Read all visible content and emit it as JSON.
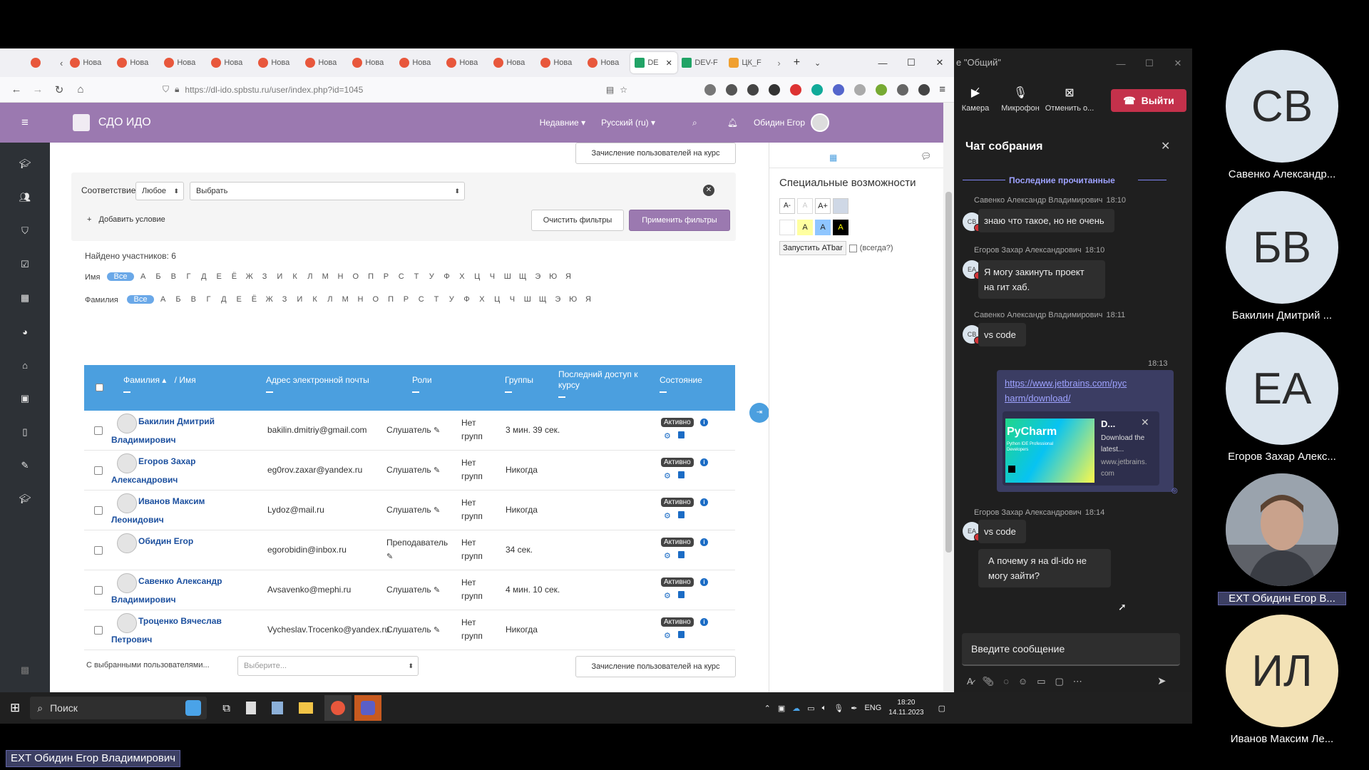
{
  "browser": {
    "tabs": [
      {
        "label": "Нова",
        "type": "moodle"
      },
      {
        "label": "Нова",
        "type": "moodle"
      },
      {
        "label": "Нова",
        "type": "moodle"
      },
      {
        "label": "Нова",
        "type": "moodle"
      },
      {
        "label": "Нова",
        "type": "moodle"
      },
      {
        "label": "Нова",
        "type": "moodle"
      },
      {
        "label": "Нова",
        "type": "moodle"
      },
      {
        "label": "Нова",
        "type": "moodle"
      },
      {
        "label": "Нова",
        "type": "moodle"
      },
      {
        "label": "Нова",
        "type": "moodle"
      },
      {
        "label": "Нова",
        "type": "moodle"
      },
      {
        "label": "Нова",
        "type": "moodle"
      }
    ],
    "active_tab": "DE",
    "tab_dev": "DEV-F",
    "tab_ck": "ЦК_F",
    "url": "https://dl-ido.spbstu.ru/user/index.php?id=1045"
  },
  "moodle": {
    "site_name": "СДО ИДО",
    "nav_recent": "Недавние",
    "nav_lang": "Русский (ru)",
    "user_name": "Обидин Егор",
    "enroll_button": "Зачисление пользователей на курс",
    "filter": {
      "match_label": "Соответствие",
      "match_value": "Любое",
      "select_value": "Выбрать",
      "add_condition": "Добавить условие",
      "clear": "Очистить фильтры",
      "apply": "Применить фильтры"
    },
    "found": "Найдено участников: 6",
    "first_name_label": "Имя",
    "last_name_label": "Фамилия",
    "all_label": "Все",
    "alphabet": [
      "А",
      "Б",
      "В",
      "Г",
      "Д",
      "Е",
      "Ё",
      "Ж",
      "З",
      "И",
      "К",
      "Л",
      "М",
      "Н",
      "О",
      "П",
      "Р",
      "С",
      "Т",
      "У",
      "Ф",
      "Х",
      "Ц",
      "Ч",
      "Ш",
      "Щ",
      "Э",
      "Ю",
      "Я"
    ],
    "table_headers": {
      "surname": "Фамилия",
      "name": "/ Имя",
      "email": "Адрес электронной почты",
      "roles": "Роли",
      "groups": "Группы",
      "last_access": "Последний доступ к курсу",
      "status": "Состояние"
    },
    "rows": [
      {
        "name": "Бакилин Дмитрий Владимирович",
        "email": "bakilin.dmitriy@gmail.com",
        "role": "Слушатель",
        "groups": "Нет групп",
        "last": "3 мин. 39 сек.",
        "status": "Активно"
      },
      {
        "name": "Егоров Захар Александрович",
        "email": "eg0rov.zaxar@yandex.ru",
        "role": "Слушатель",
        "groups": "Нет групп",
        "last": "Никогда",
        "status": "Активно"
      },
      {
        "name": "Иванов Максим Леонидович",
        "email": "Lydoz@mail.ru",
        "role": "Слушатель",
        "groups": "Нет групп",
        "last": "Никогда",
        "status": "Активно"
      },
      {
        "name": "Обидин Егор",
        "email": "egorobidin@inbox.ru",
        "role": "Преподаватель",
        "groups": "Нет групп",
        "last": "34 сек.",
        "status": "Активно"
      },
      {
        "name": "Савенко Александр Владимирович",
        "email": "Avsavenko@mephi.ru",
        "role": "Слушатель",
        "groups": "Нет групп",
        "last": "4 мин. 10 сек.",
        "status": "Активно"
      },
      {
        "name": "Троценко Вячеслав Петрович",
        "email": "Vycheslav.Trocenko@yandex.ru",
        "role": "Слушатель",
        "groups": "Нет групп",
        "last": "Никогда",
        "status": "Активно"
      }
    ],
    "with_selected": "С выбранными пользователями...",
    "with_selected_value": "Выберите...",
    "drawer_title": "Специальные возможности",
    "atbar_button": "Запустить ATbar",
    "atbar_always": "(всегда?)",
    "font_buttons": [
      "A-",
      "A",
      "A+"
    ],
    "color_buttons": [
      "A",
      "A",
      "A"
    ]
  },
  "teams": {
    "window_title": "е \"Общий\"",
    "camera": "Камера",
    "mic": "Микрофон",
    "share": "Отменить о...",
    "leave": "Выйти",
    "chat_title": "Чат собрания",
    "last_read": "Последние прочитанные",
    "messages": [
      {
        "author": "Савенко Александр Владимирович",
        "time": "18:10",
        "initials": "СВ",
        "text": "знаю что такое, но не очень"
      },
      {
        "author": "Егоров Захар Александрович",
        "time": "18:10",
        "initials": "ЕА",
        "text": "Я могу закинуть проект на гит хаб."
      },
      {
        "author": "Савенко Александр Владимирович",
        "time": "18:11",
        "initials": "СВ",
        "text": "vs code"
      },
      {
        "author": "Егоров Захар Александрович",
        "time": "18:14",
        "initials": "ЕА",
        "text": "vs code"
      }
    ],
    "own_time": "18:13",
    "own_link": "https://www.jetbrains.com/pycharm/download/",
    "preview_title": "D...",
    "preview_desc": "Download the latest...",
    "preview_site": "www.jetbrains.com",
    "preview_image_text": "PyCharm",
    "preview_image_sub": "Python IDE Professional Developers",
    "last_msg": "А почему я на dl-ido не могу зайти?",
    "input_placeholder": "Введите сообщение"
  },
  "participants": [
    {
      "initials": "СВ",
      "name": "Савенко Александр...",
      "color": "#dbe5ee"
    },
    {
      "initials": "БВ",
      "name": "Бакилин Дмитрий ...",
      "color": "#dbe5ee"
    },
    {
      "initials": "ЕА",
      "name": "Егоров Захар Алекс...",
      "color": "#dbe5ee"
    },
    {
      "initials": "",
      "name": "EXT Обидин Егор В...",
      "color": "#8a8f95"
    },
    {
      "initials": "ИЛ",
      "name": "Иванов Максим Ле...",
      "color": "#f3e2b6"
    }
  ],
  "taskbar": {
    "search": "Поиск",
    "lang": "ENG",
    "time": "18:20",
    "date": "14.11.2023"
  },
  "presenter_label": "EXT Обидин Егор Владимирович",
  "colors": {
    "moodle_header": "#9b79b0",
    "table_header": "#4b9fdf",
    "apply_button": "#9b79b0",
    "teams_leave": "#c4314b"
  }
}
